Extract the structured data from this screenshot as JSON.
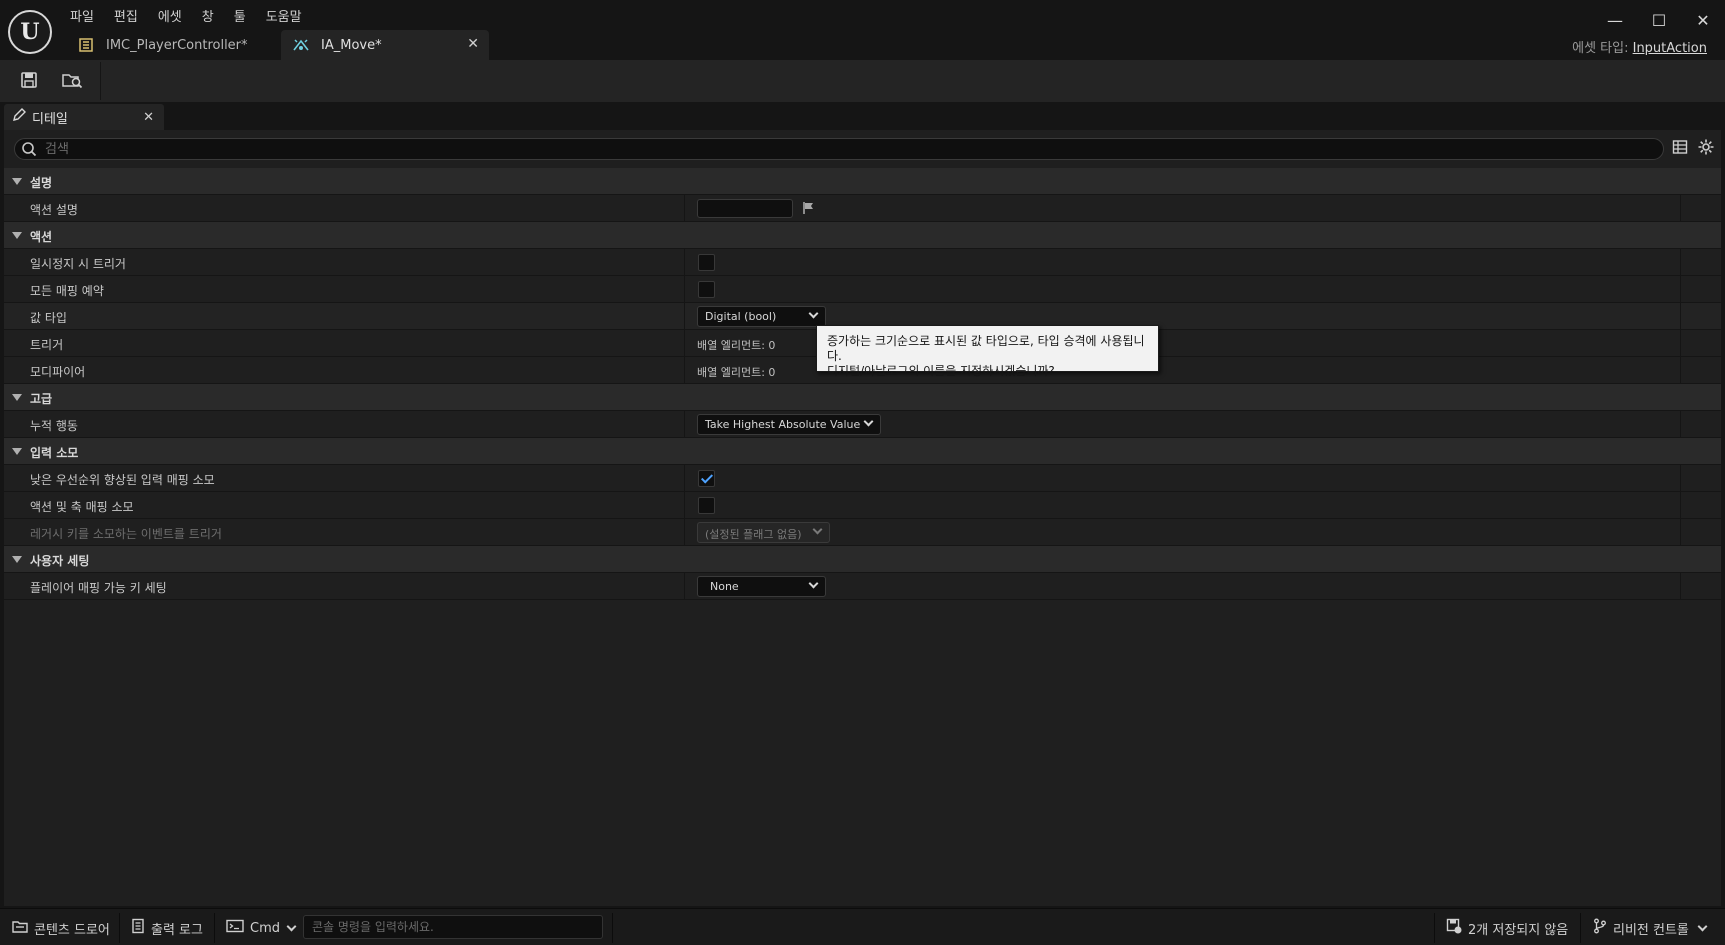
{
  "menu": [
    "파일",
    "편집",
    "에셋",
    "창",
    "툴",
    "도움말"
  ],
  "tabs": [
    {
      "label": "IMC_PlayerController*"
    },
    {
      "label": "IA_Move*",
      "active": true
    }
  ],
  "asset_type": {
    "prefix": "에셋 타입:",
    "value": "InputAction"
  },
  "details_tab": {
    "label": "디테일"
  },
  "search": {
    "placeholder": "검색"
  },
  "sections": {
    "desc": {
      "label": "설명",
      "rows": {
        "action_desc": "액션 설명"
      }
    },
    "action": {
      "label": "액션",
      "rows": {
        "trigger_when_paused": "일시정지 시 트리거",
        "reserve_all_mappings": "모든 매핑 예약",
        "value_type": "값 타입",
        "triggers": "트리거",
        "modifiers": "모디파이어"
      }
    },
    "advanced": {
      "label": "고급",
      "rows": {
        "accumulation": "누적 행동"
      }
    },
    "input_consume": {
      "label": "입력 소모",
      "rows": {
        "consume_lower_priority": "낮은 우선순위 향상된 입력 매핑 소모",
        "consume_action_axis": "액션 및 축 매핑 소모",
        "legacy_trigger": "레거시 키를 소모하는 이벤트를 트리거"
      }
    },
    "user_settings": {
      "label": "사용자 세팅",
      "rows": {
        "player_mappable": "플레이어 매핑 가능 키 세팅"
      }
    }
  },
  "values": {
    "value_type": "Digital (bool)",
    "triggers_array": "배열 엘리먼트: 0",
    "modifiers_array": "배열 엘리먼트: 0",
    "accumulation": "Take Highest Absolute Value",
    "legacy_trigger": "(설정된 플래그 없음)",
    "player_mappable": "None",
    "trigger_when_paused": false,
    "reserve_all_mappings": false,
    "consume_lower_priority": true,
    "consume_action_axis": false
  },
  "tooltip": {
    "line1": "증가하는 크기순으로 표시된 값 타입으로, 타입 승격에 사용됩니다.",
    "line2": "디지털/아날로그의 이름을 지정하시겠습니까?"
  },
  "statusbar": {
    "content_drawer": "콘텐츠 드로어",
    "output_log": "출력 로그",
    "cmd": "Cmd",
    "cmd_placeholder": "콘솔 명령을 입력하세요.",
    "unsaved": "2개 저장되지 않음",
    "revision_control": "리비전 컨트롤"
  },
  "colors": {
    "accent": "#4fa3ff",
    "background": "#151515",
    "panel": "#1f1f1f",
    "category": "#2a2a2a"
  }
}
